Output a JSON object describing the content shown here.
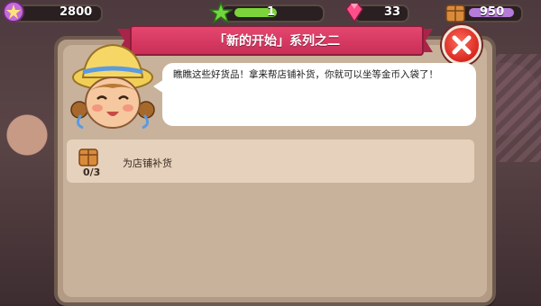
{
  "hud": {
    "coins": "2800",
    "level": "1",
    "level_progress": 0.42,
    "gems": "33",
    "crates": "950"
  },
  "dialog": {
    "title": "「新的开始」系列之二",
    "speech": "瞧瞧这些好货品！拿来帮店铺补货，你就可以坐等金币入袋了！"
  },
  "task": {
    "progress": "0/3",
    "label": "为店铺补货"
  },
  "colors": {
    "ribbon": "#d93a63",
    "close": "#d8281f",
    "panel": "#c9b29b"
  }
}
